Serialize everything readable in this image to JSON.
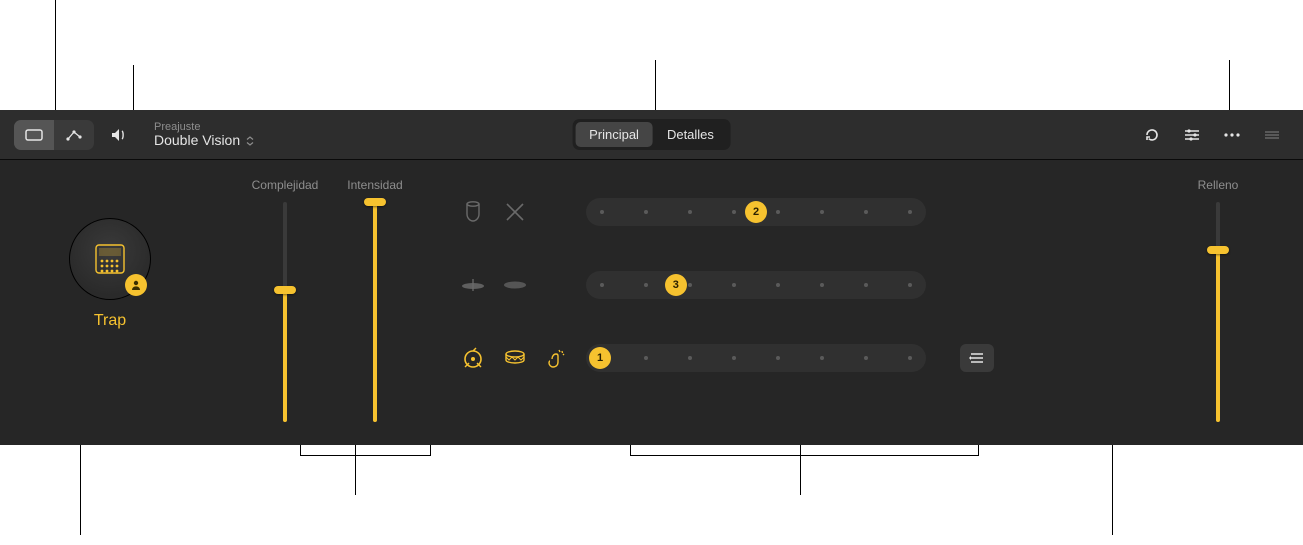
{
  "toolbar": {
    "preset_label": "Preajuste",
    "preset_value": "Double Vision"
  },
  "tabs": {
    "main": "Principal",
    "details": "Detalles",
    "active": "main"
  },
  "style": {
    "name": "Trap"
  },
  "sliders": {
    "complexity": {
      "label": "Complejidad",
      "value": 0.6
    },
    "intensity": {
      "label": "Intensidad",
      "value": 1.0
    },
    "fill": {
      "label": "Relleno",
      "value": 0.78
    }
  },
  "rows": [
    {
      "name": "percussion",
      "icons": [
        {
          "name": "conga-icon",
          "on": false
        },
        {
          "name": "sticks-icon",
          "on": false
        }
      ],
      "value": 2,
      "min": 1,
      "max": 8,
      "has_menu": false
    },
    {
      "name": "hihat",
      "icons": [
        {
          "name": "cymbal-closed-icon",
          "on": false
        },
        {
          "name": "cymbal-open-icon",
          "on": false
        }
      ],
      "value": 3,
      "min": 1,
      "max": 8,
      "has_menu": false
    },
    {
      "name": "kicksnare",
      "icons": [
        {
          "name": "kick-icon",
          "on": true
        },
        {
          "name": "snare-icon",
          "on": true
        },
        {
          "name": "clap-icon",
          "on": true
        }
      ],
      "value": 1,
      "min": 1,
      "max": 8,
      "has_menu": true
    }
  ],
  "colors": {
    "accent": "#f6c22f",
    "background": "#1b1b1b"
  }
}
